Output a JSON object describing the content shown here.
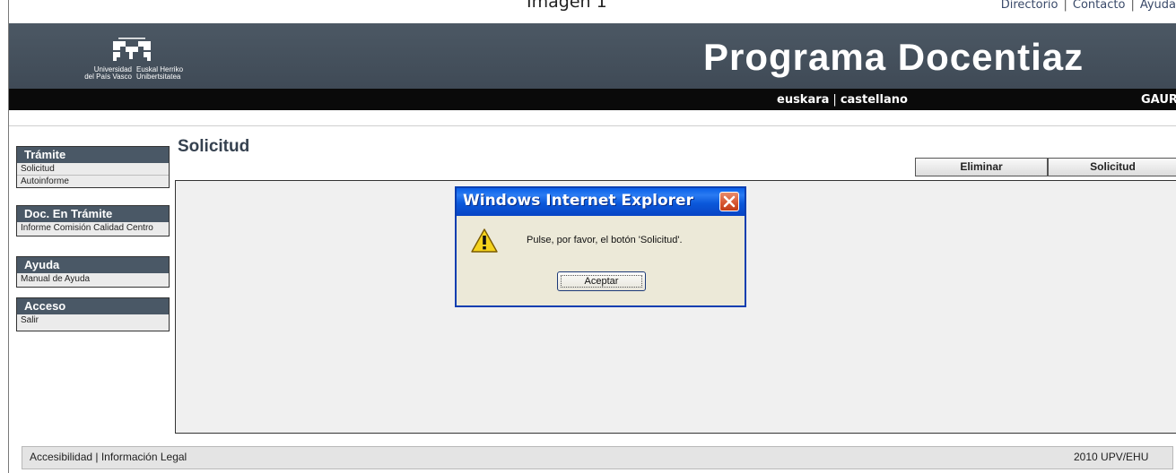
{
  "caption": "Imagen 1",
  "top_links": [
    "Directorio",
    "Contacto",
    "Ayuda"
  ],
  "banner": {
    "logo_text_left": [
      "Universidad",
      "del País Vasco"
    ],
    "logo_text_right": [
      "Euskal Herriko",
      "Unibertsitatea"
    ],
    "title": "Programa Docentiaz"
  },
  "nav": {
    "lang_eu": "euskara",
    "lang_es": "castellano",
    "right_label": "GAUR"
  },
  "sidebar": [
    {
      "heading": "Trámite",
      "items": [
        "Solicitud",
        "Autoinforme"
      ]
    },
    {
      "heading": "Doc. En Trámite",
      "items": [
        "Informe Comisión Calidad Centro"
      ]
    },
    {
      "heading": "Ayuda",
      "items": [
        "Manual de Ayuda"
      ]
    },
    {
      "heading": "Acceso",
      "items": [
        "Salir"
      ]
    }
  ],
  "page_title": "Solicitud",
  "actions": {
    "delete": "Eliminar",
    "request": "Solicitud"
  },
  "footer": {
    "left": "Accesibilidad | Información Legal",
    "right": "2010 UPV/EHU"
  },
  "dialog": {
    "title": "Windows Internet Explorer",
    "message": "Pulse, por favor, el botón 'Solicitud'.",
    "ok_label": "Aceptar",
    "icon": "warning-icon"
  },
  "colors": {
    "banner": "#44505c",
    "navbar": "#0a0a0a",
    "dialog_title": "#0a5fe8"
  }
}
